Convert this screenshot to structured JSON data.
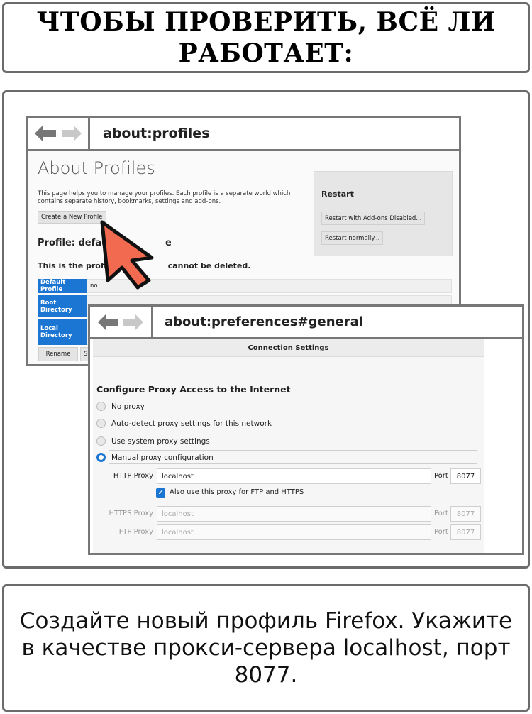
{
  "title": {
    "line1": "ЧТОБЫ ПРОВЕРИТЬ, ВСЁ ЛИ",
    "line2": "РАБОТАЕТ:"
  },
  "caption": {
    "line1": "Создайте новый профиль Firefox. Укажите",
    "line2": "в качестве прокси-сервера localhost, порт",
    "line3": "8077."
  },
  "window_profiles": {
    "url": "about:profiles",
    "page_title": "About Profiles",
    "description": "This page helps you to manage your profiles. Each profile is a separate world which contains separate history, bookmarks, settings and add-ons.",
    "create_button": "Create a New Profile",
    "profile_heading": "Profile: default",
    "profile_heading_tail": "e",
    "profile_note_a": "This is the profile in",
    "profile_note_b": "cannot be deleted.",
    "restart": {
      "label": "Restart",
      "addons_button": "Restart with Add-ons Disabled...",
      "normal_button": "Restart normally..."
    },
    "table": [
      {
        "label": "Default Profile",
        "value": "no"
      },
      {
        "label": "Root Directory",
        "value": ""
      },
      {
        "label": "Local Directory",
        "value": ""
      }
    ],
    "rename_button": "Rename",
    "partial_button": "Se"
  },
  "window_prefs": {
    "url": "about:preferences#general",
    "dialog_title": "Connection Settings",
    "section_title": "Configure Proxy Access to the Internet",
    "options": [
      {
        "label": "No proxy",
        "selected": false
      },
      {
        "label": "Auto-detect proxy settings for this network",
        "selected": false
      },
      {
        "label": "Use system proxy settings",
        "selected": false
      },
      {
        "label": "Manual proxy configuration",
        "selected": true
      }
    ],
    "http": {
      "label": "HTTP Proxy",
      "value": "localhost",
      "port_label": "Port",
      "port": "8077"
    },
    "also_use": "Also use this proxy for FTP and HTTPS",
    "https": {
      "label": "HTTPS Proxy",
      "value": "localhost",
      "port_label": "Port",
      "port": "8077"
    },
    "ftp": {
      "label": "FTP Proxy",
      "value": "localhost",
      "port_label": "Port",
      "port": "8077"
    }
  },
  "colors": {
    "accent": "#1a76d2",
    "cursor": "#f26a4f",
    "frame": "#6b6b6b"
  },
  "icons": [
    "back-arrow-icon",
    "forward-arrow-icon",
    "mouse-pointer-icon",
    "checkmark-icon"
  ]
}
